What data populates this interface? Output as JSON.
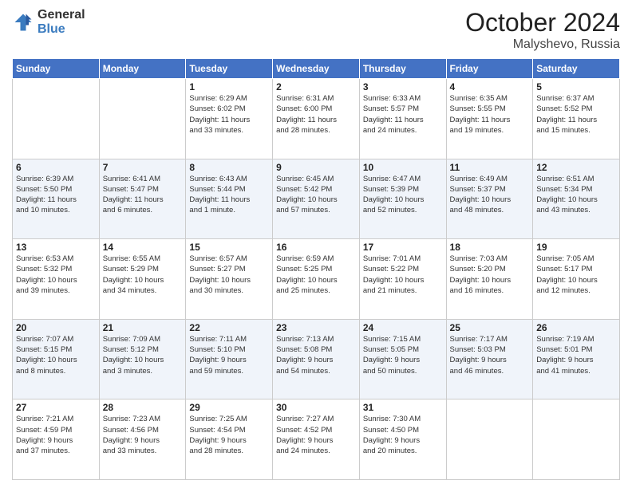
{
  "logo": {
    "general": "General",
    "blue": "Blue"
  },
  "title": {
    "month_year": "October 2024",
    "location": "Malyshevo, Russia"
  },
  "weekdays": [
    "Sunday",
    "Monday",
    "Tuesday",
    "Wednesday",
    "Thursday",
    "Friday",
    "Saturday"
  ],
  "weeks": [
    [
      {
        "day": "",
        "info": ""
      },
      {
        "day": "",
        "info": ""
      },
      {
        "day": "1",
        "info": "Sunrise: 6:29 AM\nSunset: 6:02 PM\nDaylight: 11 hours\nand 33 minutes."
      },
      {
        "day": "2",
        "info": "Sunrise: 6:31 AM\nSunset: 6:00 PM\nDaylight: 11 hours\nand 28 minutes."
      },
      {
        "day": "3",
        "info": "Sunrise: 6:33 AM\nSunset: 5:57 PM\nDaylight: 11 hours\nand 24 minutes."
      },
      {
        "day": "4",
        "info": "Sunrise: 6:35 AM\nSunset: 5:55 PM\nDaylight: 11 hours\nand 19 minutes."
      },
      {
        "day": "5",
        "info": "Sunrise: 6:37 AM\nSunset: 5:52 PM\nDaylight: 11 hours\nand 15 minutes."
      }
    ],
    [
      {
        "day": "6",
        "info": "Sunrise: 6:39 AM\nSunset: 5:50 PM\nDaylight: 11 hours\nand 10 minutes."
      },
      {
        "day": "7",
        "info": "Sunrise: 6:41 AM\nSunset: 5:47 PM\nDaylight: 11 hours\nand 6 minutes."
      },
      {
        "day": "8",
        "info": "Sunrise: 6:43 AM\nSunset: 5:44 PM\nDaylight: 11 hours\nand 1 minute."
      },
      {
        "day": "9",
        "info": "Sunrise: 6:45 AM\nSunset: 5:42 PM\nDaylight: 10 hours\nand 57 minutes."
      },
      {
        "day": "10",
        "info": "Sunrise: 6:47 AM\nSunset: 5:39 PM\nDaylight: 10 hours\nand 52 minutes."
      },
      {
        "day": "11",
        "info": "Sunrise: 6:49 AM\nSunset: 5:37 PM\nDaylight: 10 hours\nand 48 minutes."
      },
      {
        "day": "12",
        "info": "Sunrise: 6:51 AM\nSunset: 5:34 PM\nDaylight: 10 hours\nand 43 minutes."
      }
    ],
    [
      {
        "day": "13",
        "info": "Sunrise: 6:53 AM\nSunset: 5:32 PM\nDaylight: 10 hours\nand 39 minutes."
      },
      {
        "day": "14",
        "info": "Sunrise: 6:55 AM\nSunset: 5:29 PM\nDaylight: 10 hours\nand 34 minutes."
      },
      {
        "day": "15",
        "info": "Sunrise: 6:57 AM\nSunset: 5:27 PM\nDaylight: 10 hours\nand 30 minutes."
      },
      {
        "day": "16",
        "info": "Sunrise: 6:59 AM\nSunset: 5:25 PM\nDaylight: 10 hours\nand 25 minutes."
      },
      {
        "day": "17",
        "info": "Sunrise: 7:01 AM\nSunset: 5:22 PM\nDaylight: 10 hours\nand 21 minutes."
      },
      {
        "day": "18",
        "info": "Sunrise: 7:03 AM\nSunset: 5:20 PM\nDaylight: 10 hours\nand 16 minutes."
      },
      {
        "day": "19",
        "info": "Sunrise: 7:05 AM\nSunset: 5:17 PM\nDaylight: 10 hours\nand 12 minutes."
      }
    ],
    [
      {
        "day": "20",
        "info": "Sunrise: 7:07 AM\nSunset: 5:15 PM\nDaylight: 10 hours\nand 8 minutes."
      },
      {
        "day": "21",
        "info": "Sunrise: 7:09 AM\nSunset: 5:12 PM\nDaylight: 10 hours\nand 3 minutes."
      },
      {
        "day": "22",
        "info": "Sunrise: 7:11 AM\nSunset: 5:10 PM\nDaylight: 9 hours\nand 59 minutes."
      },
      {
        "day": "23",
        "info": "Sunrise: 7:13 AM\nSunset: 5:08 PM\nDaylight: 9 hours\nand 54 minutes."
      },
      {
        "day": "24",
        "info": "Sunrise: 7:15 AM\nSunset: 5:05 PM\nDaylight: 9 hours\nand 50 minutes."
      },
      {
        "day": "25",
        "info": "Sunrise: 7:17 AM\nSunset: 5:03 PM\nDaylight: 9 hours\nand 46 minutes."
      },
      {
        "day": "26",
        "info": "Sunrise: 7:19 AM\nSunset: 5:01 PM\nDaylight: 9 hours\nand 41 minutes."
      }
    ],
    [
      {
        "day": "27",
        "info": "Sunrise: 7:21 AM\nSunset: 4:59 PM\nDaylight: 9 hours\nand 37 minutes."
      },
      {
        "day": "28",
        "info": "Sunrise: 7:23 AM\nSunset: 4:56 PM\nDaylight: 9 hours\nand 33 minutes."
      },
      {
        "day": "29",
        "info": "Sunrise: 7:25 AM\nSunset: 4:54 PM\nDaylight: 9 hours\nand 28 minutes."
      },
      {
        "day": "30",
        "info": "Sunrise: 7:27 AM\nSunset: 4:52 PM\nDaylight: 9 hours\nand 24 minutes."
      },
      {
        "day": "31",
        "info": "Sunrise: 7:30 AM\nSunset: 4:50 PM\nDaylight: 9 hours\nand 20 minutes."
      },
      {
        "day": "",
        "info": ""
      },
      {
        "day": "",
        "info": ""
      }
    ]
  ]
}
